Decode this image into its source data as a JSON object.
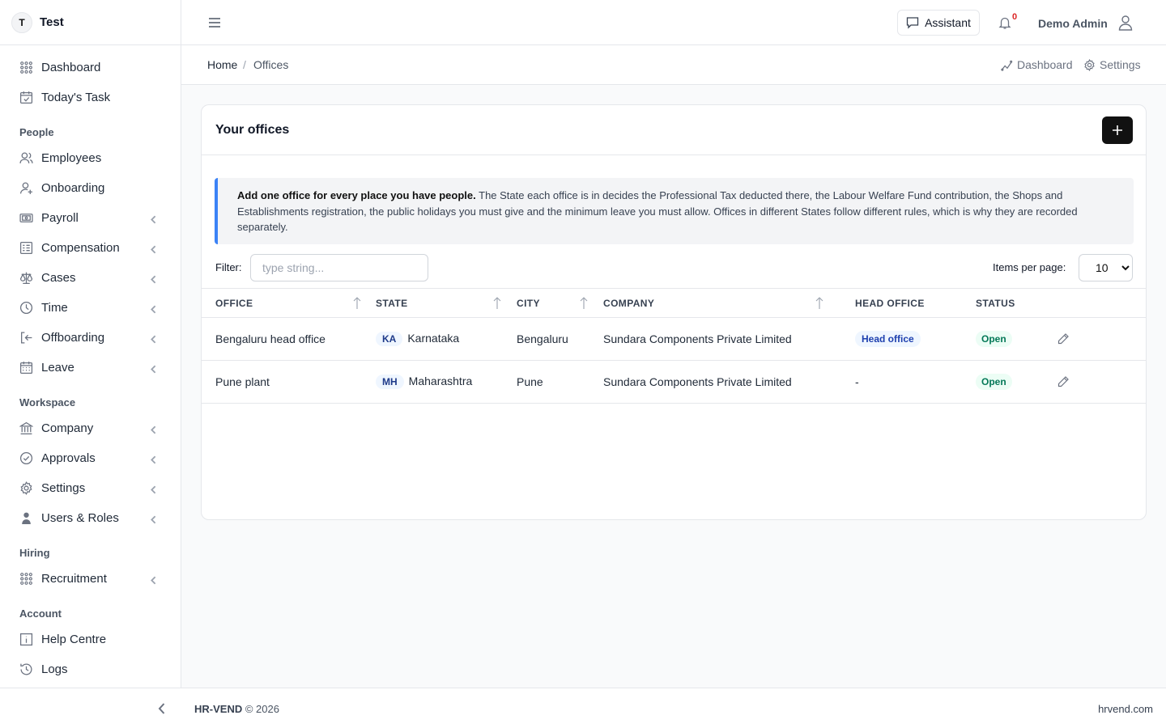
{
  "brand": {
    "initial": "T",
    "name": "Test"
  },
  "sidebar": {
    "items": [
      {
        "label": "Dashboard",
        "icon": "grid-icon"
      },
      {
        "label": "Today's Task",
        "icon": "calendar-check-icon"
      },
      {
        "label": "Employees",
        "icon": "users-icon"
      },
      {
        "label": "Onboarding",
        "icon": "user-plus-icon"
      },
      {
        "label": "Payroll",
        "icon": "money-icon"
      },
      {
        "label": "Compensation",
        "icon": "ledger-icon"
      },
      {
        "label": "Cases",
        "icon": "scales-icon"
      },
      {
        "label": "Time",
        "icon": "clock-icon"
      },
      {
        "label": "Offboarding",
        "icon": "exit-icon"
      },
      {
        "label": "Leave",
        "icon": "calendar-icon"
      },
      {
        "label": "Company",
        "icon": "bank-icon"
      },
      {
        "label": "Approvals",
        "icon": "check-circle-icon"
      },
      {
        "label": "Settings",
        "icon": "gear-icon"
      },
      {
        "label": "Users & Roles",
        "icon": "user-shield-icon"
      },
      {
        "label": "Recruitment",
        "icon": "grid-icon"
      },
      {
        "label": "Help Centre",
        "icon": "info-icon"
      },
      {
        "label": "Logs",
        "icon": "history-icon"
      }
    ],
    "sections": {
      "people": "People",
      "workspace": "Workspace",
      "hiring": "Hiring",
      "account": "Account"
    }
  },
  "topbar": {
    "assistant_label": "Assistant",
    "notification_count": "0",
    "user_name": "Demo Admin"
  },
  "breadcrumb": {
    "home": "Home",
    "separator": "/",
    "current": "Offices"
  },
  "quick_links": {
    "dashboard": "Dashboard",
    "settings": "Settings"
  },
  "card": {
    "title": "Your offices",
    "notice_bold": "Add one office for every place you have people.",
    "notice_text": " The State each office is in decides the Professional Tax deducted there, the Labour Welfare Fund contribution, the Shops and Establishments registration, the public holidays you must give and the minimum leave you must allow. Offices in different States follow different rules, which is why they are recorded separately.",
    "filter_label": "Filter:",
    "filter_placeholder": "type string...",
    "items_per_page_label": "Items per page:",
    "items_per_page": "10"
  },
  "table": {
    "columns": [
      "OFFICE",
      "STATE",
      "CITY",
      "COMPANY",
      "HEAD OFFICE",
      "STATUS"
    ],
    "rows": [
      {
        "office": "Bengaluru head office",
        "state_code": "KA",
        "state": "Karnataka",
        "city": "Bengaluru",
        "company": "Sundara Components Private Limited",
        "head_office": "Head office",
        "status": "Open"
      },
      {
        "office": "Pune plant",
        "state_code": "MH",
        "state": "Maharashtra",
        "city": "Pune",
        "company": "Sundara Components Private Limited",
        "head_office": "-",
        "status": "Open"
      }
    ]
  },
  "footer": {
    "brand": "HR-VEND",
    "copyright": "© 2026",
    "site": "hrvend.com"
  }
}
